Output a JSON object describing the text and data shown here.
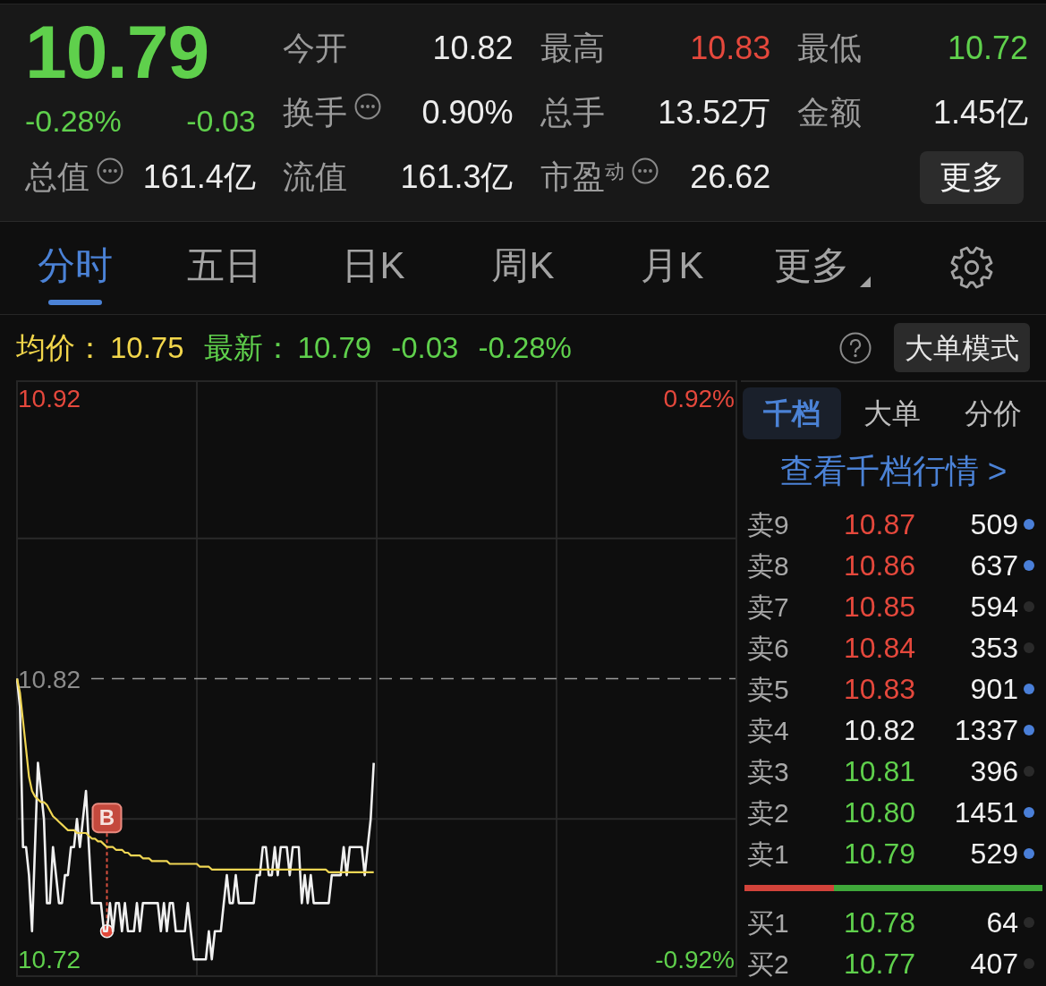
{
  "header": {
    "cells": [
      {
        "kind": "price",
        "value": "10.79",
        "color": "#5fd04c"
      },
      {
        "kind": "stat",
        "label": "今开",
        "info": false,
        "value": "10.82",
        "color": "#ededed"
      },
      {
        "kind": "stat",
        "label": "最高",
        "info": false,
        "value": "10.83",
        "color": "#e5483c"
      },
      {
        "kind": "stat",
        "label": "最低",
        "info": false,
        "value": "10.72",
        "color": "#5fd04c"
      },
      {
        "kind": "change",
        "values": [
          "-0.28%",
          "-0.03"
        ],
        "color": "#5fd04c"
      },
      {
        "kind": "stat",
        "label": "换手",
        "info": true,
        "value": "0.90%",
        "color": "#ededed"
      },
      {
        "kind": "stat",
        "label": "总手",
        "info": false,
        "value": "13.52万",
        "color": "#ededed"
      },
      {
        "kind": "stat",
        "label": "金额",
        "info": false,
        "value": "1.45亿",
        "color": "#ededed"
      },
      {
        "kind": "stat",
        "label": "总值",
        "info": true,
        "value": "161.4亿",
        "color": "#ededed"
      },
      {
        "kind": "stat",
        "label": "流值",
        "info": false,
        "value": "161.3亿",
        "color": "#ededed"
      },
      {
        "kind": "stat",
        "label": "市盈$^{动}$",
        "info": true,
        "value": "26.62",
        "color": "#ededed"
      },
      {
        "kind": "button",
        "label": "更多"
      }
    ]
  },
  "tabs": [
    {
      "label": "分时",
      "selected": true,
      "menu": false
    },
    {
      "label": "五日",
      "selected": false,
      "menu": false
    },
    {
      "label": "日K",
      "selected": false,
      "menu": false
    },
    {
      "label": "周K",
      "selected": false,
      "menu": false
    },
    {
      "label": "月K",
      "selected": false,
      "menu": false
    },
    {
      "label": "更多",
      "selected": false,
      "menu": true
    }
  ],
  "summary": {
    "average": {
      "label": "均价：",
      "value": "10.75"
    },
    "latest": {
      "label": "最新：",
      "value": "10.79",
      "change": "-0.03",
      "change_percent": "-0.28%",
      "color": "#5fd04c"
    },
    "mode_button": "大单模式"
  },
  "chart": {
    "chart_data": {
      "type": "line",
      "ylim": [
        10.714,
        10.926
      ],
      "yticks": [
        10.92,
        10.82,
        10.72
      ],
      "categories": [
        null,
        null,
        null,
        null,
        null,
        null,
        null,
        null,
        null,
        null,
        null,
        null,
        null,
        null,
        null,
        null,
        null,
        null,
        null,
        null,
        null,
        null,
        null,
        null,
        null,
        null,
        null,
        null,
        null,
        null,
        null,
        null,
        null,
        null,
        null,
        null,
        null,
        null,
        null,
        null,
        null,
        null,
        null,
        null,
        null,
        null,
        null,
        null,
        null,
        null,
        null,
        null,
        null,
        null,
        null,
        null,
        null,
        null,
        null,
        null,
        null,
        null,
        null,
        null,
        null,
        null,
        null,
        null,
        null,
        null,
        null,
        null,
        null,
        null,
        null,
        null,
        null,
        null,
        null,
        null,
        null,
        null,
        null,
        null,
        null,
        null,
        null,
        null,
        null,
        null,
        null,
        null,
        null,
        null,
        null,
        null,
        null,
        null,
        null,
        null,
        null,
        null,
        null,
        null,
        null,
        null,
        null,
        null,
        null,
        null,
        null,
        null,
        null,
        null,
        null,
        null,
        null,
        null,
        null,
        null,
        null,
        null,
        null,
        null,
        null,
        null,
        null,
        null,
        null,
        null,
        null,
        null,
        null,
        null,
        null,
        null,
        null,
        null,
        null,
        null,
        null,
        null,
        null,
        null,
        null,
        null,
        null,
        null,
        null,
        null,
        null,
        null,
        null,
        null,
        null,
        null,
        null,
        null,
        null,
        null,
        null,
        null,
        null,
        null,
        null,
        null,
        null,
        null,
        null,
        null,
        null,
        null,
        null,
        null,
        null,
        null,
        null,
        null,
        null,
        null,
        null,
        null,
        null,
        null,
        null,
        null,
        null,
        null,
        null,
        null,
        null,
        null,
        null,
        null,
        null,
        null,
        null,
        null,
        null,
        null,
        null,
        null,
        null,
        null,
        null,
        null,
        null,
        null,
        null,
        null,
        null,
        null,
        null,
        null,
        null,
        null,
        null,
        null,
        null,
        null,
        null,
        null,
        null,
        null,
        null,
        null,
        null,
        null,
        null,
        null,
        null,
        null,
        null,
        null,
        null,
        null,
        null,
        null,
        null,
        null,
        null
      ],
      "series": [
        {
          "color": "#f0f0f0",
          "values": [
            10.82,
            10.81,
            10.76,
            10.76,
            10.75,
            10.73,
            10.76,
            10.79,
            10.78,
            10.77,
            10.74,
            10.74,
            10.76,
            10.75,
            10.74,
            10.74,
            10.75,
            10.75,
            10.76,
            10.76,
            10.77,
            10.76,
            10.77,
            10.78,
            10.76,
            10.74,
            10.74,
            10.74,
            10.74,
            10.73,
            10.73,
            10.74,
            10.73,
            10.74,
            10.74,
            10.73,
            10.74,
            10.73,
            10.73,
            10.73,
            10.74,
            10.73,
            10.74,
            10.74,
            10.74,
            10.74,
            10.74,
            10.74,
            10.73,
            10.74,
            10.73,
            10.74,
            10.74,
            10.73,
            10.73,
            10.73,
            10.73,
            10.74,
            10.73,
            10.72,
            10.72,
            10.72,
            10.72,
            10.72,
            10.73,
            10.72,
            10.73,
            10.73,
            10.73,
            10.74,
            10.75,
            10.74,
            10.74,
            10.75,
            10.74,
            10.74,
            10.74,
            10.74,
            10.74,
            10.74,
            10.75,
            10.75,
            10.76,
            10.76,
            10.75,
            10.75,
            10.76,
            10.75,
            10.76,
            10.76,
            10.76,
            10.75,
            10.76,
            10.76,
            10.76,
            10.74,
            10.75,
            10.74,
            10.75,
            10.74,
            10.74,
            10.74,
            10.74,
            10.74,
            10.74,
            10.75,
            10.75,
            10.75,
            10.75,
            10.76,
            10.75,
            10.76,
            10.76,
            10.76,
            10.76,
            10.76,
            10.75,
            10.76,
            10.77,
            10.79,
            null,
            null,
            null,
            null,
            null,
            null,
            null,
            null,
            null,
            null,
            null,
            null,
            null,
            null,
            null,
            null,
            null,
            null,
            null,
            null,
            null,
            null,
            null,
            null,
            null,
            null,
            null,
            null,
            null,
            null,
            null,
            null,
            null,
            null,
            null,
            null,
            null,
            null,
            null,
            null,
            null,
            null,
            null,
            null,
            null,
            null,
            null,
            null,
            null,
            null,
            null,
            null,
            null,
            null,
            null,
            null,
            null,
            null,
            null,
            null,
            null,
            null,
            null,
            null,
            null,
            null,
            null,
            null,
            null,
            null,
            null,
            null,
            null,
            null,
            null,
            null,
            null,
            null,
            null,
            null,
            null,
            null,
            null,
            null,
            null,
            null,
            null,
            null,
            null,
            null,
            null,
            null,
            null,
            null,
            null,
            null,
            null,
            null,
            null,
            null,
            null,
            null,
            null,
            null,
            null,
            null,
            null,
            null,
            null,
            null,
            null,
            null,
            null,
            null,
            null,
            null,
            null,
            null,
            null,
            null,
            null
          ]
        },
        {
          "color": "#f0d654",
          "values": [
            10.82,
            10.815,
            10.805,
            10.795,
            10.785,
            10.78,
            10.778,
            10.777,
            10.776,
            10.776,
            10.775,
            10.773,
            10.771,
            10.77,
            10.769,
            10.768,
            10.767,
            10.766,
            10.766,
            10.766,
            10.765,
            10.765,
            10.765,
            10.765,
            10.764,
            10.763,
            10.763,
            10.762,
            10.762,
            10.761,
            10.76,
            10.76,
            10.76,
            10.759,
            10.759,
            10.759,
            10.758,
            10.758,
            10.757,
            10.757,
            10.757,
            10.757,
            10.756,
            10.756,
            10.756,
            10.755,
            10.755,
            10.755,
            10.755,
            10.755,
            10.755,
            10.754,
            10.754,
            10.754,
            10.754,
            10.754,
            10.754,
            10.754,
            10.754,
            10.754,
            10.754,
            10.753,
            10.753,
            10.753,
            10.753,
            10.752,
            10.752,
            10.752,
            10.752,
            10.752,
            10.752,
            10.752,
            10.752,
            10.752,
            10.752,
            10.752,
            10.752,
            10.752,
            10.752,
            10.752,
            10.752,
            10.752,
            10.752,
            10.752,
            10.752,
            10.752,
            10.752,
            10.752,
            10.752,
            10.752,
            10.752,
            10.752,
            10.752,
            10.752,
            10.752,
            10.752,
            10.752,
            10.752,
            10.752,
            10.752,
            10.752,
            10.752,
            10.752,
            10.752,
            10.751,
            10.751,
            10.751,
            10.751,
            10.751,
            10.751,
            10.751,
            10.751,
            10.751,
            10.751,
            10.751,
            10.751,
            10.751,
            10.751,
            10.751,
            10.751,
            null,
            null,
            null,
            null,
            null,
            null,
            null,
            null,
            null,
            null,
            null,
            null,
            null,
            null,
            null,
            null,
            null,
            null,
            null,
            null,
            null,
            null,
            null,
            null,
            null,
            null,
            null,
            null,
            null,
            null,
            null,
            null,
            null,
            null,
            null,
            null,
            null,
            null,
            null,
            null,
            null,
            null,
            null,
            null,
            null,
            null,
            null,
            null,
            null,
            null,
            null,
            null,
            null,
            null,
            null,
            null,
            null,
            null,
            null,
            null,
            null,
            null,
            null,
            null,
            null,
            null,
            null,
            null,
            null,
            null,
            null,
            null,
            null,
            null,
            null,
            null,
            null,
            null,
            null,
            null,
            null,
            null,
            null,
            null,
            null,
            null,
            null,
            null,
            null,
            null,
            null,
            null,
            null,
            null,
            null,
            null,
            null,
            null,
            null,
            null,
            null,
            null,
            null,
            null,
            null,
            null,
            null,
            null,
            null,
            null,
            null,
            null,
            null,
            null,
            null,
            null,
            null,
            null,
            null,
            null,
            null
          ]
        }
      ],
      "ref_lines": [
        {
          "axis": "y",
          "value": 10.87
        },
        {
          "axis": "y",
          "value": 10.82
        },
        {
          "axis": "y",
          "value": 10.77
        }
      ]
    },
    "trade_marker": {
      "label": "B"
    },
    "percent_labels": [
      {
        "text": "0.92%",
        "color": "#e5483c"
      },
      {
        "text": "-0.92%",
        "color": "#5fd04c"
      }
    ]
  },
  "order_book": {
    "tabs": [
      {
        "label": "千档",
        "selected": true
      },
      {
        "label": "大单",
        "selected": false
      },
      {
        "label": "分价",
        "selected": false
      }
    ],
    "link": "查看千档行情 >",
    "asks": [
      {
        "label": "卖9",
        "price": {
          "value": "10.87",
          "color": "#e5483c"
        },
        "volume": "509",
        "color": "#4a7fd8"
      },
      {
        "label": "卖8",
        "price": {
          "value": "10.86",
          "color": "#e5483c"
        },
        "volume": "637",
        "color": "#4a7fd8"
      },
      {
        "label": "卖7",
        "price": {
          "value": "10.85",
          "color": "#e5483c"
        },
        "volume": "594",
        "color": "#2a2a2a"
      },
      {
        "label": "卖6",
        "price": {
          "value": "10.84",
          "color": "#e5483c"
        },
        "volume": "353",
        "color": "#2a2a2a"
      },
      {
        "label": "卖5",
        "price": {
          "value": "10.83",
          "color": "#e5483c"
        },
        "volume": "901",
        "color": "#4a7fd8"
      },
      {
        "label": "卖4",
        "price": {
          "value": "10.82",
          "color": "#ededed"
        },
        "volume": "1337",
        "color": "#4a7fd8"
      },
      {
        "label": "卖3",
        "price": {
          "value": "10.81",
          "color": "#5fd04c"
        },
        "volume": "396",
        "color": "#2a2a2a"
      },
      {
        "label": "卖2",
        "price": {
          "value": "10.80",
          "color": "#5fd04c"
        },
        "volume": "1451",
        "color": "#4a7fd8"
      },
      {
        "label": "卖1",
        "price": {
          "value": "10.79",
          "color": "#5fd04c"
        },
        "volume": "529",
        "color": "#4a7fd8"
      }
    ],
    "ratio_bar": {
      "level": 0.3
    },
    "bids": [
      {
        "label": "买1",
        "price": {
          "value": "10.78",
          "color": "#5fd04c"
        },
        "volume": "64",
        "color": "#2a2a2a"
      },
      {
        "label": "买2",
        "price": {
          "value": "10.77",
          "color": "#5fd04c"
        },
        "volume": "407",
        "color": "#2a2a2a"
      }
    ]
  }
}
